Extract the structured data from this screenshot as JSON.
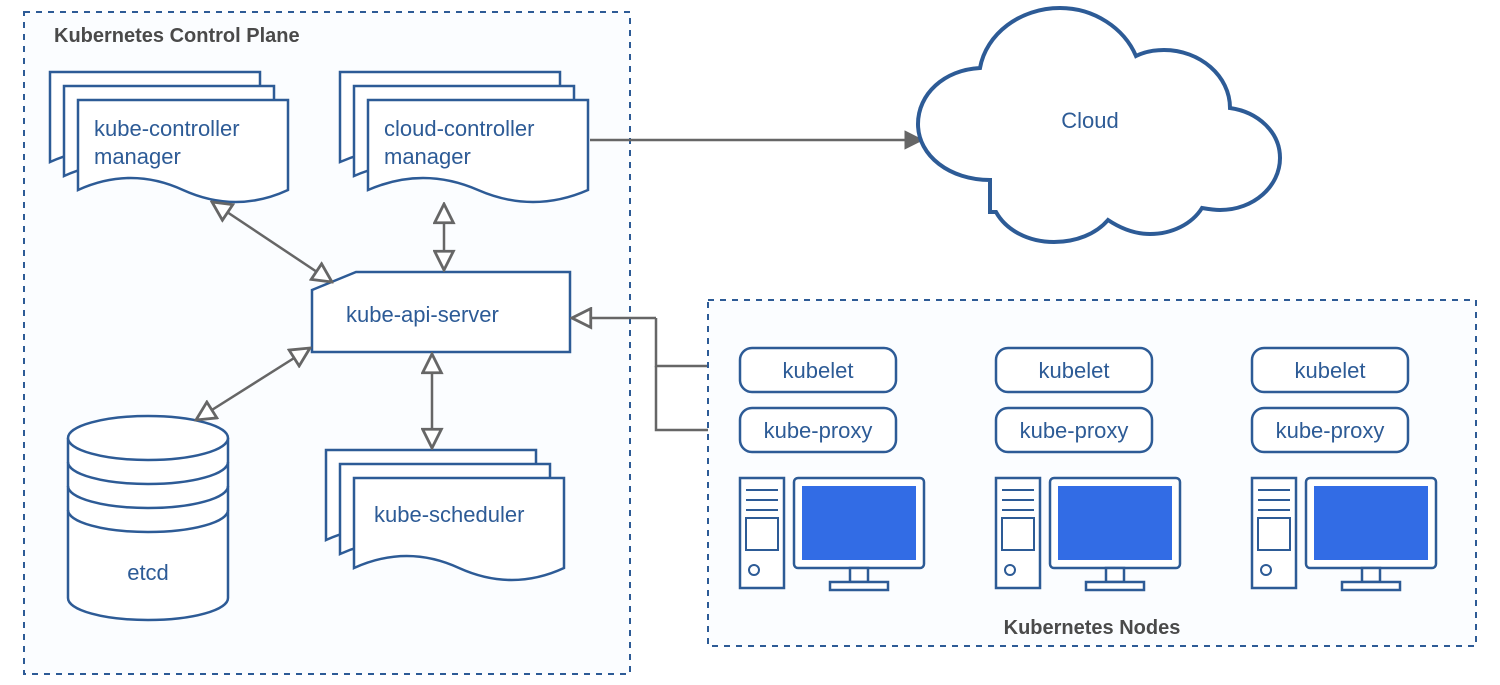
{
  "diagram": {
    "controlPlane": {
      "title": "Kubernetes Control Plane",
      "components": {
        "kubeControllerManager": {
          "line1": "kube-controller",
          "line2": "manager"
        },
        "cloudControllerManager": {
          "line1": "cloud-controller",
          "line2": "manager"
        },
        "kubeApiServer": "kube-api-server",
        "kubeScheduler": "kube-scheduler",
        "etcd": "etcd"
      }
    },
    "cloud": {
      "label": "Cloud"
    },
    "nodes": {
      "title": "Kubernetes Nodes",
      "nodeComponents": {
        "kubelet": "kubelet",
        "kubeProxy": "kube-proxy"
      }
    }
  },
  "colors": {
    "blue": "#326ce5",
    "darkBlue": "#2d5b96",
    "grey": "#666666",
    "lightBg": "#fbfdff"
  }
}
